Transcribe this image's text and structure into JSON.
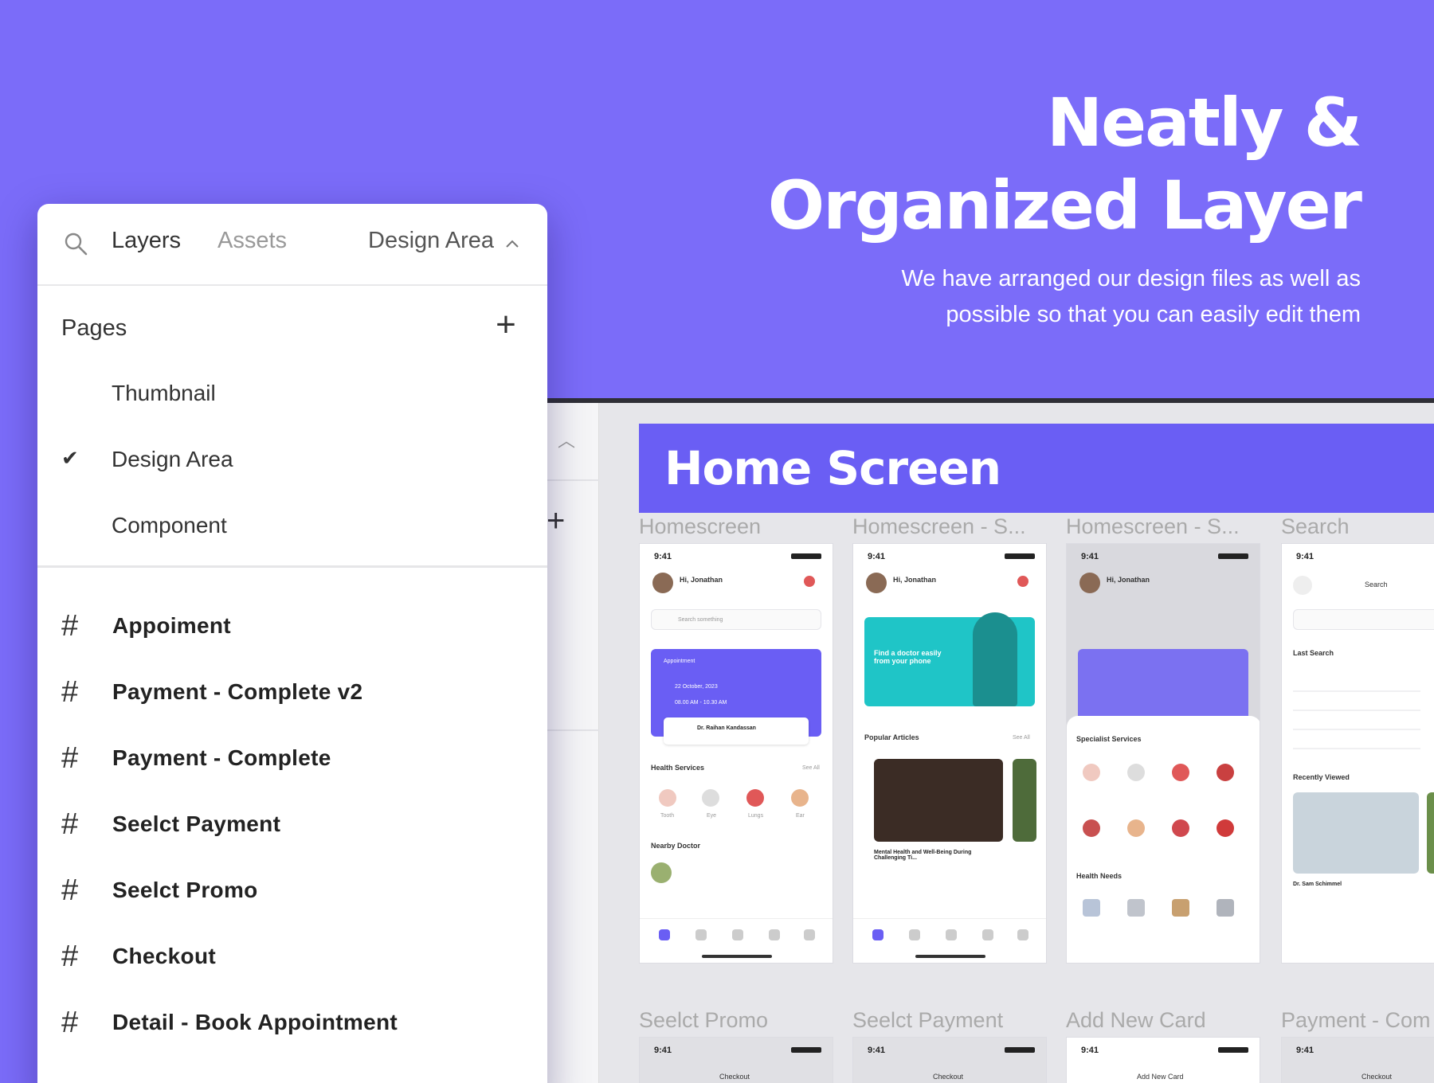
{
  "hero": {
    "title_line1": "Neatly &",
    "title_line2": "Organized Layer",
    "subtitle_line1": "We have arranged our design files as well as",
    "subtitle_line2": "possible so that you can easily edit them"
  },
  "panel": {
    "tabs": {
      "layers": "Layers",
      "assets": "Assets",
      "current_page": "Design Area"
    },
    "pages_heading": "Pages",
    "pages": [
      {
        "label": "Thumbnail",
        "selected": false
      },
      {
        "label": "Design Area",
        "selected": true
      },
      {
        "label": "Component",
        "selected": false
      }
    ],
    "layers": [
      "Appoiment",
      "Payment - Complete v2",
      "Payment - Complete",
      "Seelct Payment",
      "Seelct Promo",
      "Checkout",
      "Detail - Book Appointment"
    ]
  },
  "canvas": {
    "section_title": "Home Screen",
    "frames_row1": [
      "Homescreen",
      "Homescreen - S...",
      "Homescreen - S...",
      "Search"
    ],
    "frames_row2": [
      "Seelct Promo",
      "Seelct Payment",
      "Add New Card",
      "Payment - Com"
    ],
    "phone": {
      "time": "9:41",
      "greeting": "Hi, Jonathan",
      "search_placeholder": "Search something",
      "appointment": "Appointment",
      "date": "22 October, 2023",
      "time_range": "08.00 AM - 10.30 AM",
      "doctor": "Dr. Raihan Kandassan",
      "health_services": "Health Services",
      "see_all": "See All",
      "services": [
        "Tooth",
        "Eye",
        "Lungs",
        "Ear"
      ],
      "nearby": "Nearby Doctor",
      "promo": "Find a doctor easily from your phone",
      "popular": "Popular Articles",
      "article": "Mental Health and Well-Being During Challenging Ti...",
      "specialist": "Specialist Services",
      "health_needs": "Health Needs",
      "search_title": "Search",
      "last_search": "Last Search",
      "recently": "Recently Viewed",
      "recent_doc": "Dr. Sam Schimmel",
      "checkout": "Checkout",
      "add_card": "Add New Card"
    }
  },
  "colors": {
    "accent": "#7b6cf9",
    "banner": "#6a5ef4",
    "teal": "#1fc5c7"
  },
  "icons": {
    "search": "search-icon",
    "chevron": "chevron-up-icon",
    "check": "check-icon",
    "hash": "frame-hash-icon",
    "plus": "plus-icon"
  }
}
